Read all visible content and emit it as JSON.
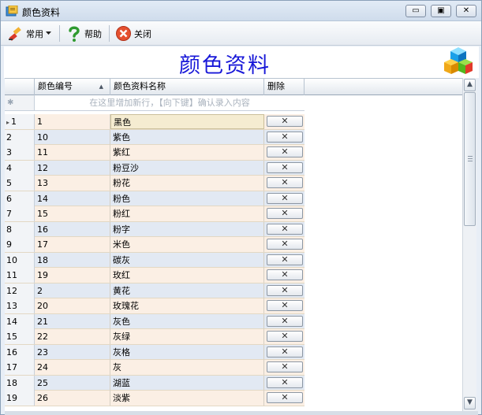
{
  "window": {
    "title": "颜色资料",
    "min_symbol": "▭",
    "max_symbol": "▣",
    "close_symbol": "✕"
  },
  "toolbar": {
    "common_label": "常用",
    "help_label": "帮助",
    "close_label": "关闭"
  },
  "banner": {
    "title": "颜色资料"
  },
  "grid": {
    "columns": {
      "code": "颜色编号",
      "name": "颜色资料名称",
      "delete": "删除"
    },
    "sort_indicator": "▲",
    "new_row_marker": "✱",
    "new_row_hint": "在这里增加新行，【向下键】确认录入内容",
    "delete_symbol": "✕",
    "current_row_marker": "▸",
    "rows": [
      {
        "n": "1",
        "code": "1",
        "name": "黑色"
      },
      {
        "n": "2",
        "code": "10",
        "name": "紫色"
      },
      {
        "n": "3",
        "code": "11",
        "name": "紫红"
      },
      {
        "n": "4",
        "code": "12",
        "name": "粉豆沙"
      },
      {
        "n": "5",
        "code": "13",
        "name": "粉花"
      },
      {
        "n": "6",
        "code": "14",
        "name": "粉色"
      },
      {
        "n": "7",
        "code": "15",
        "name": "粉红"
      },
      {
        "n": "8",
        "code": "16",
        "name": "粉字"
      },
      {
        "n": "9",
        "code": "17",
        "name": "米色"
      },
      {
        "n": "10",
        "code": "18",
        "name": "碳灰"
      },
      {
        "n": "11",
        "code": "19",
        "name": "玫红"
      },
      {
        "n": "12",
        "code": "2",
        "name": "黄花"
      },
      {
        "n": "13",
        "code": "20",
        "name": "玫瑰花"
      },
      {
        "n": "14",
        "code": "21",
        "name": "灰色"
      },
      {
        "n": "15",
        "code": "22",
        "name": "灰绿"
      },
      {
        "n": "16",
        "code": "23",
        "name": "灰格"
      },
      {
        "n": "17",
        "code": "24",
        "name": "灰"
      },
      {
        "n": "18",
        "code": "25",
        "name": "湖蓝"
      },
      {
        "n": "19",
        "code": "26",
        "name": "淡紫"
      }
    ]
  },
  "scrollbar": {
    "up": "▲",
    "down": "▼"
  },
  "colors": {
    "banner_title": "#1818d8",
    "row_odd": "#fbefe4",
    "row_even": "#e2e9f3"
  }
}
